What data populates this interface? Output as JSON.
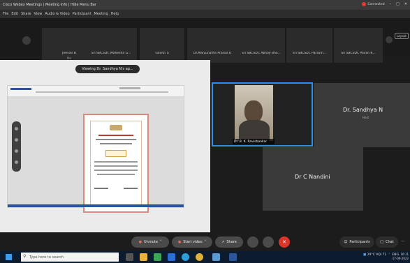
{
  "window": {
    "title": "Cisco Webex Meetings  |  Meeting Info  |  Hide Menu Bar",
    "connection_status": "Connected"
  },
  "menu": [
    "File",
    "Edit",
    "Share",
    "View",
    "Audio & Video",
    "Participant",
    "Meeting",
    "Help"
  ],
  "participant_strip": {
    "thumbnails": [
      {
        "name": "Jeevan B",
        "sub": "Me"
      },
      {
        "name": "Sri SBCSDC Mahesha G...",
        "sub": ""
      },
      {
        "name": "Gavitri S",
        "sub": ""
      },
      {
        "name": "Dr.Manjunatha Prasad K",
        "sub": ""
      },
      {
        "name": "Sri SBCSDC Abhay Bha...",
        "sub": ""
      },
      {
        "name": "Sri SBCSDC Paravin...",
        "sub": ""
      },
      {
        "name": "Sri SBCSDC Pavan K...",
        "sub": ""
      }
    ],
    "layout_button": "Layout"
  },
  "share": {
    "viewing_label": "Viewing Dr. Sandhya N's ap..."
  },
  "video_tiles": [
    {
      "name": "Dr. B. K. Ravishankar",
      "sub": ""
    },
    {
      "name": "Dr. Sandhya N",
      "sub": "Host"
    },
    {
      "name": "Dr C Nandini",
      "sub": ""
    }
  ],
  "controls": {
    "unmute": "Unmute",
    "start_video": "Start video",
    "share": "Share",
    "participants": "Participants",
    "chat": "Chat"
  },
  "taskbar": {
    "search_placeholder": "Type here to search",
    "weather": "29°C AQI 71",
    "language": "ENG",
    "time": "16:11",
    "date": "17-09-2022"
  },
  "colors": {
    "accent_blue": "#2f8ee5",
    "leave_red": "#d9352b",
    "connected_red": "#e23b2e"
  }
}
